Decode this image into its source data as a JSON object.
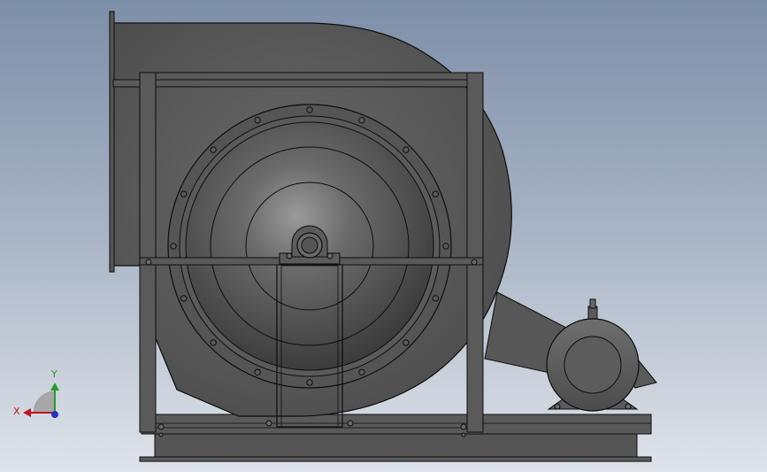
{
  "viewport": {
    "background_top": "#7d8ea8",
    "background_bottom": "#dfe3ea",
    "model": "centrifugal-fan-with-motor",
    "view": "side"
  },
  "triad": {
    "x_label": "X",
    "y_label": "Y",
    "x_color": "#c0141c",
    "y_color": "#2a9a2a"
  },
  "colors": {
    "body": "#5c5c5c",
    "body_dark": "#3a3a3a",
    "edge": "#0d0d0d",
    "frame": "#595959",
    "motor": "#5e5e5e"
  }
}
